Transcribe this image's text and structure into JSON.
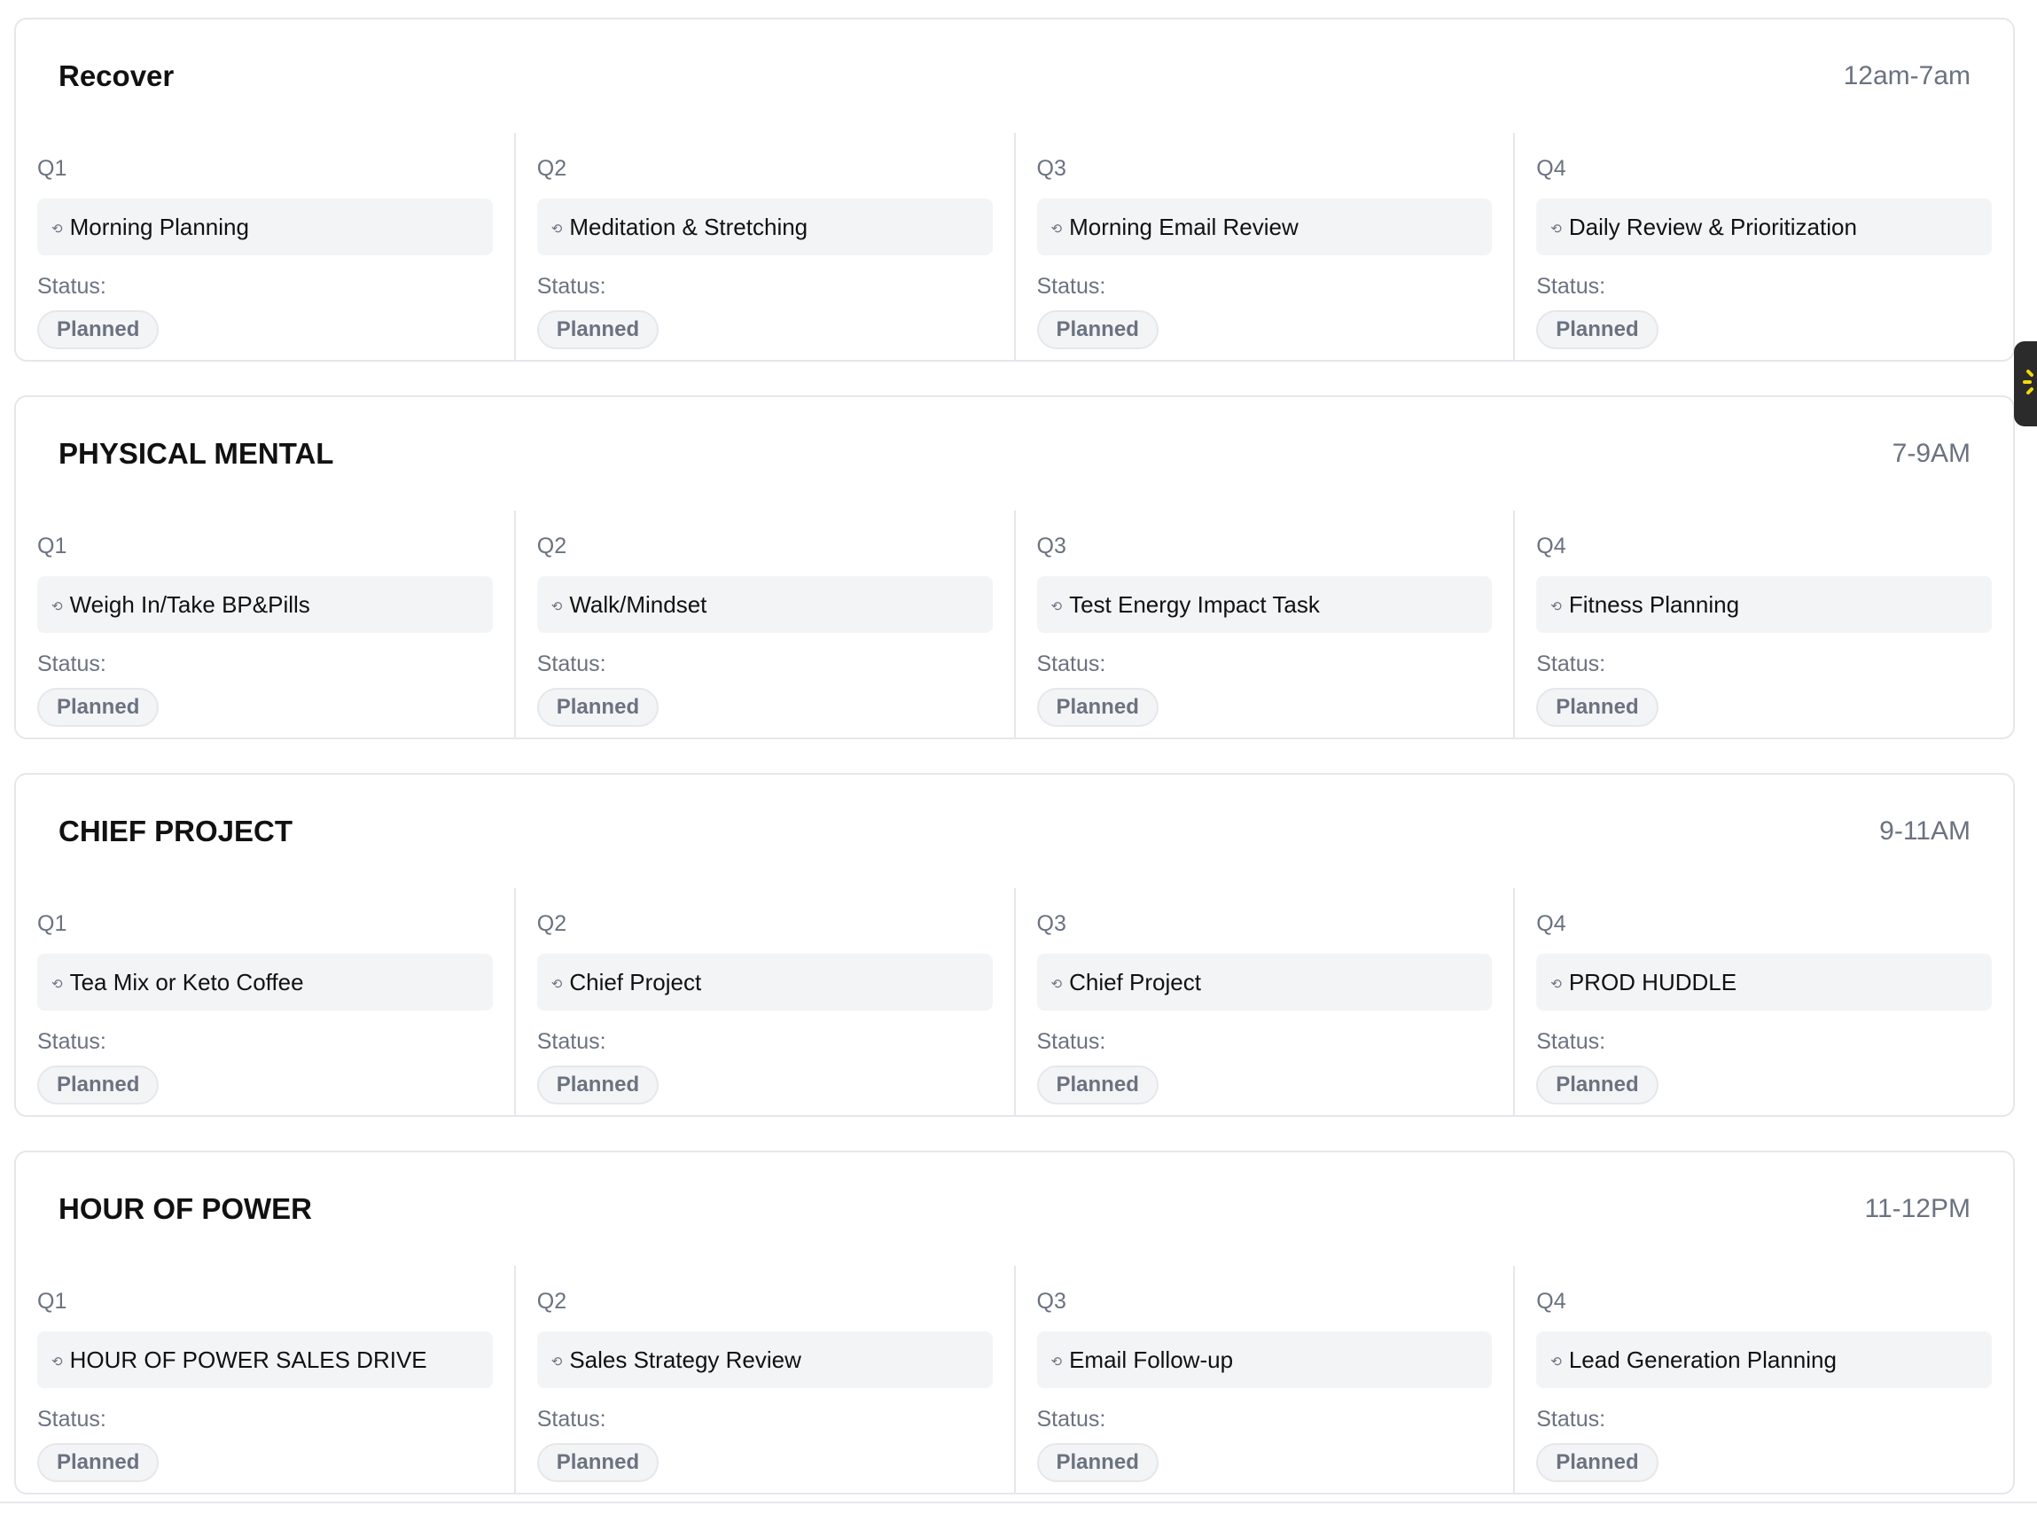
{
  "blocks": [
    {
      "title": "Recover",
      "time": "12am-7am",
      "quarters": [
        {
          "label": "Q1",
          "task": "Morning Planning",
          "status_label": "Status:",
          "status": "Planned"
        },
        {
          "label": "Q2",
          "task": "Meditation & Stretching",
          "status_label": "Status:",
          "status": "Planned"
        },
        {
          "label": "Q3",
          "task": "Morning Email Review",
          "status_label": "Status:",
          "status": "Planned"
        },
        {
          "label": "Q4",
          "task": "Daily Review & Prioritization",
          "status_label": "Status:",
          "status": "Planned"
        }
      ]
    },
    {
      "title": "PHYSICAL MENTAL",
      "time": "7-9AM",
      "quarters": [
        {
          "label": "Q1",
          "task": "Weigh In/Take BP&Pills",
          "status_label": "Status:",
          "status": "Planned"
        },
        {
          "label": "Q2",
          "task": "Walk/Mindset",
          "status_label": "Status:",
          "status": "Planned"
        },
        {
          "label": "Q3",
          "task": "Test Energy Impact Task",
          "status_label": "Status:",
          "status": "Planned"
        },
        {
          "label": "Q4",
          "task": "Fitness Planning",
          "status_label": "Status:",
          "status": "Planned"
        }
      ]
    },
    {
      "title": "CHIEF PROJECT",
      "time": "9-11AM",
      "quarters": [
        {
          "label": "Q1",
          "task": "Tea Mix or Keto Coffee",
          "status_label": "Status:",
          "status": "Planned"
        },
        {
          "label": "Q2",
          "task": "Chief Project",
          "status_label": "Status:",
          "status": "Planned"
        },
        {
          "label": "Q3",
          "task": "Chief Project",
          "status_label": "Status:",
          "status": "Planned"
        },
        {
          "label": "Q4",
          "task": "PROD HUDDLE",
          "status_label": "Status:",
          "status": "Planned"
        }
      ]
    },
    {
      "title": "HOUR OF POWER",
      "time": "11-12PM",
      "quarters": [
        {
          "label": "Q1",
          "task": "HOUR OF POWER SALES DRIVE",
          "status_label": "Status:",
          "status": "Planned"
        },
        {
          "label": "Q2",
          "task": "Sales Strategy Review",
          "status_label": "Status:",
          "status": "Planned"
        },
        {
          "label": "Q3",
          "task": "Email Follow-up",
          "status_label": "Status:",
          "status": "Planned"
        },
        {
          "label": "Q4",
          "task": "Lead Generation Planning",
          "status_label": "Status:",
          "status": "Planned"
        }
      ]
    }
  ],
  "icons": {
    "task_icon": "recurring-icon",
    "side_tab_icon": "sun-icon"
  },
  "colors": {
    "panel_border": "#e5e7eb",
    "chip_background": "#f3f4f6",
    "muted_text": "#6b7280",
    "side_tab_background": "#2b2b2b",
    "side_tab_accent": "#f5d90a"
  }
}
